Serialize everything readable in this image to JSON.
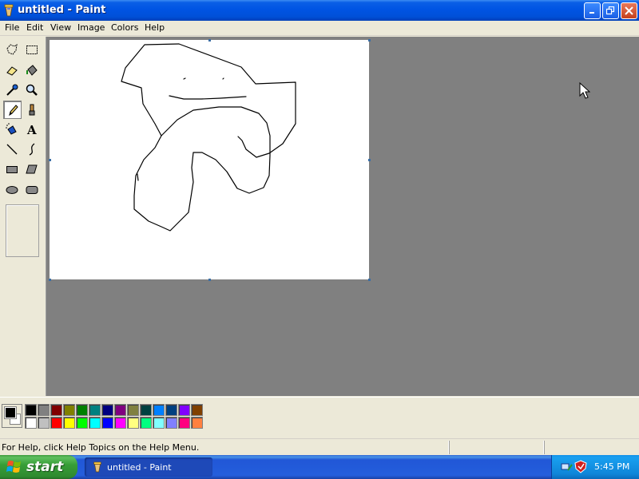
{
  "window": {
    "title": "untitled - Paint"
  },
  "menu": [
    "File",
    "Edit",
    "View",
    "Image",
    "Colors",
    "Help"
  ],
  "tools": [
    {
      "name": "free-form-select"
    },
    {
      "name": "select"
    },
    {
      "name": "eraser"
    },
    {
      "name": "fill-with-color"
    },
    {
      "name": "pick-color"
    },
    {
      "name": "magnifier"
    },
    {
      "name": "pencil",
      "selected": true
    },
    {
      "name": "brush"
    },
    {
      "name": "airbrush"
    },
    {
      "name": "text"
    },
    {
      "name": "line"
    },
    {
      "name": "curve"
    },
    {
      "name": "rectangle"
    },
    {
      "name": "polygon"
    },
    {
      "name": "ellipse"
    },
    {
      "name": "rounded-rectangle"
    }
  ],
  "colors": {
    "foreground": "#000000",
    "background": "#ffffff",
    "palette_top": [
      "#000000",
      "#808080",
      "#800000",
      "#808000",
      "#008000",
      "#008080",
      "#000080",
      "#800080",
      "#808040",
      "#004040",
      "#0080ff",
      "#004080",
      "#8000ff",
      "#804000"
    ],
    "palette_bottom": [
      "#ffffff",
      "#c0c0c0",
      "#ff0000",
      "#ffff00",
      "#00ff00",
      "#00ffff",
      "#0000ff",
      "#ff00ff",
      "#ffff80",
      "#00ff80",
      "#80ffff",
      "#8080ff",
      "#ff0080",
      "#ff8040"
    ]
  },
  "status": {
    "help_text": "For Help, click Help Topics on the Help Menu."
  },
  "taskbar": {
    "start_label": "start",
    "task_label": "untitled - Paint",
    "clock": "5:45 PM"
  }
}
